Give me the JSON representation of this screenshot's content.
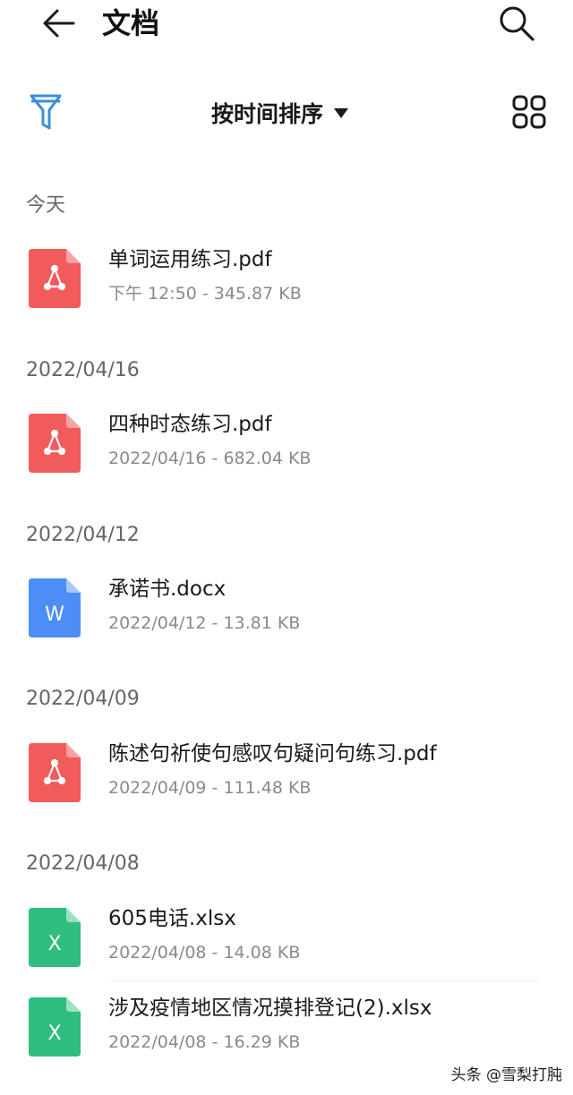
{
  "header": {
    "title": "文档",
    "back_icon": "arrow-left-icon",
    "search_icon": "search-icon"
  },
  "toolbar": {
    "filter_icon": "filter-icon",
    "sort_label": "按时间排序",
    "grid_icon": "grid-view-icon"
  },
  "colors": {
    "pdf": "#f25b5b",
    "doc": "#4c8df6",
    "xls": "#2fbe7f",
    "filter_accent": "#3b8fd9"
  },
  "sections": [
    {
      "header": "今天",
      "files": [
        {
          "name": "单词运用练习.pdf",
          "meta": "下午 12:50  - 345.87 KB",
          "type": "pdf"
        }
      ]
    },
    {
      "header": "2022/04/16",
      "files": [
        {
          "name": "四种时态练习.pdf",
          "meta": "2022/04/16 - 682.04 KB",
          "type": "pdf"
        }
      ]
    },
    {
      "header": "2022/04/12",
      "files": [
        {
          "name": "承诺书.docx",
          "meta": "2022/04/12 - 13.81 KB",
          "type": "doc",
          "glyph": "W"
        }
      ]
    },
    {
      "header": "2022/04/09",
      "files": [
        {
          "name": "陈述句祈使句感叹句疑问句练习.pdf",
          "meta": "2022/04/09 - 111.48 KB",
          "type": "pdf"
        }
      ]
    },
    {
      "header": "2022/04/08",
      "files": [
        {
          "name": "605电话.xlsx",
          "meta": "2022/04/08 - 14.08 KB",
          "type": "xls",
          "glyph": "X"
        },
        {
          "name": "涉及疫情地区情况摸排登记(2).xlsx",
          "meta": "2022/04/08 - 16.29 KB",
          "type": "xls",
          "glyph": "X"
        }
      ]
    }
  ],
  "watermark": "头条 @雪梨打肫"
}
